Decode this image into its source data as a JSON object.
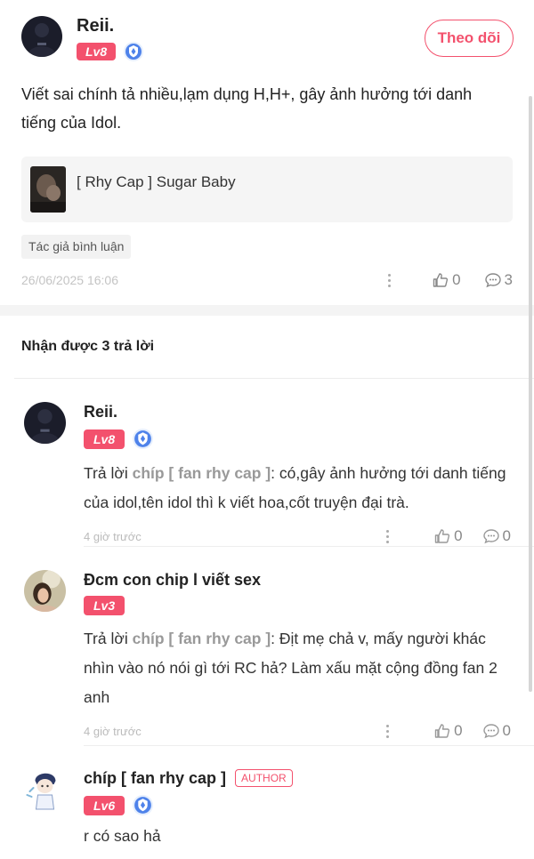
{
  "post": {
    "author": {
      "name": "Reii.",
      "level": "Lv8"
    },
    "follow_label": "Theo dõi",
    "content": "Viết sai chính tả nhiều,lạm dụng H,H+, gây ảnh hưởng tới danh tiếng của Idol.",
    "linked_story": {
      "title": "[ Rhy Cap ] Sugar Baby"
    },
    "tag": "Tác giả bình luận",
    "timestamp": "26/06/2025 16:06",
    "likes": "0",
    "comments": "3"
  },
  "replies_header": "Nhận được 3 trả lời",
  "replies": [
    {
      "name": "Reii.",
      "level": "Lv8",
      "reply_prefix": "Trả lời",
      "mention": "chíp [ fan rhy cap ]",
      "text": ": có,gây ảnh hưởng tới danh tiếng của idol,tên idol thì k viết hoa,cốt truyện đại trà.",
      "time": "4 giờ trước",
      "likes": "0",
      "comments": "0"
    },
    {
      "name": "Đcm con chip l viết sex",
      "level": "Lv3",
      "reply_prefix": "Trả lời",
      "mention": "chíp [ fan rhy cap ]",
      "text": ": Địt mẹ chả v, mấy người khác nhìn vào nó nói gì tới RC hả? Làm xấu mặt cộng đồng fan 2 anh",
      "time": "4 giờ trước",
      "likes": "0",
      "comments": "0"
    },
    {
      "name": "chíp [ fan rhy cap ]",
      "author_tag": "AUTHOR",
      "level": "Lv6",
      "text": "r có sao hả"
    }
  ],
  "colors": {
    "accent": "#f3516d",
    "muted": "#999999",
    "divider": "#f4f4f4"
  },
  "icons": [
    "shield-icon",
    "thumbs-up-icon",
    "comment-icon",
    "more-icon"
  ]
}
